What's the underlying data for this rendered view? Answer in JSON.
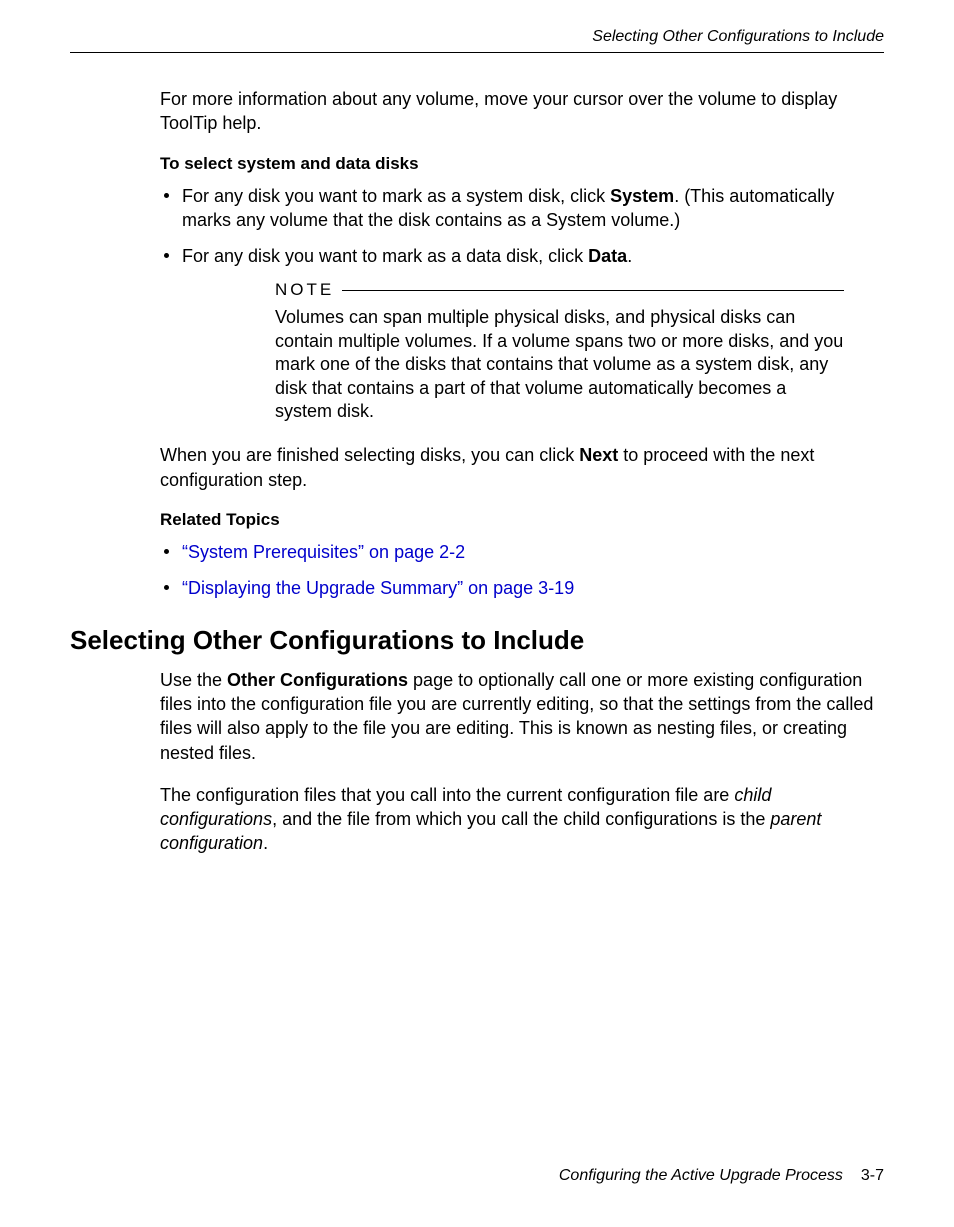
{
  "header": {
    "running_title": "Selecting Other Configurations to Include"
  },
  "body": {
    "intro": "For more information about any volume, move your cursor over the volume to display ToolTip help.",
    "to_select_heading": "To select system and data disks",
    "bullet1_pre": "For any disk you want to mark as a system disk, click ",
    "bullet1_bold": "System",
    "bullet1_post": ". (This automatically marks any volume that the disk contains as a System volume.)",
    "bullet2_pre": "For any disk you want to mark as a data disk, click ",
    "bullet2_bold": "Data",
    "bullet2_post": ".",
    "note_label": "NOTE",
    "note_body": "Volumes can span multiple physical disks, and physical disks can contain multiple volumes. If a volume spans two or more disks, and you mark one of the disks that contains that volume as a system disk, any disk that contains a part of that volume automatically becomes a system disk.",
    "after_note_pre": "When you are finished selecting disks, you can click ",
    "after_note_bold": "Next",
    "after_note_post": " to proceed with the next configuration step.",
    "related_heading": "Related Topics",
    "related_link1": "“System Prerequisites” on page 2-2",
    "related_link2": "“Displaying the Upgrade Summary” on page 3-19",
    "section_heading": "Selecting Other Configurations to Include",
    "sec_p1_pre": "Use the ",
    "sec_p1_bold": "Other Configurations",
    "sec_p1_post": " page to optionally call one or more existing configuration files into the configuration file you are currently editing, so that the settings from the called files will also apply to the file you are editing. This is known as nesting files, or creating nested files.",
    "sec_p2_a": "The configuration files that you call into the current configuration file are ",
    "sec_p2_it1": "child configurations",
    "sec_p2_b": ", and the file from which you call the child configurations is the ",
    "sec_p2_it2": "parent configuration",
    "sec_p2_c": "."
  },
  "footer": {
    "title": "Configuring the Active Upgrade Process",
    "page": "3-7"
  }
}
